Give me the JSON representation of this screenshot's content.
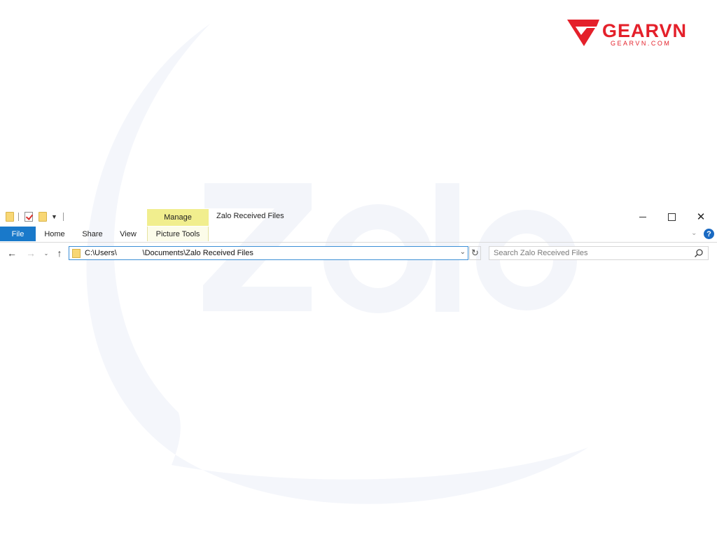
{
  "brand": {
    "name": "GEARVN",
    "domain": "GEARVN.COM",
    "color": "#e4202a"
  },
  "watermark_text": "Zalo",
  "window": {
    "title": "Zalo Received Files",
    "contextual_tab": "Manage",
    "controls": {
      "minimize_icon": "minimize-icon",
      "maximize_icon": "maximize-icon",
      "close_icon": "close-icon"
    }
  },
  "quick_access": {
    "icons": [
      "folder-icon",
      "properties-icon",
      "new-folder-icon",
      "customize-dropdown-icon"
    ]
  },
  "ribbon": {
    "tabs": [
      "File",
      "Home",
      "Share",
      "View",
      "Picture Tools"
    ],
    "accent": "#1979ca",
    "manage_accent": "#f1ee8e"
  },
  "navigation": {
    "address": "C:\\Users\\            \\Documents\\Zalo Received Files",
    "search_placeholder": "Search Zalo Received Files"
  }
}
